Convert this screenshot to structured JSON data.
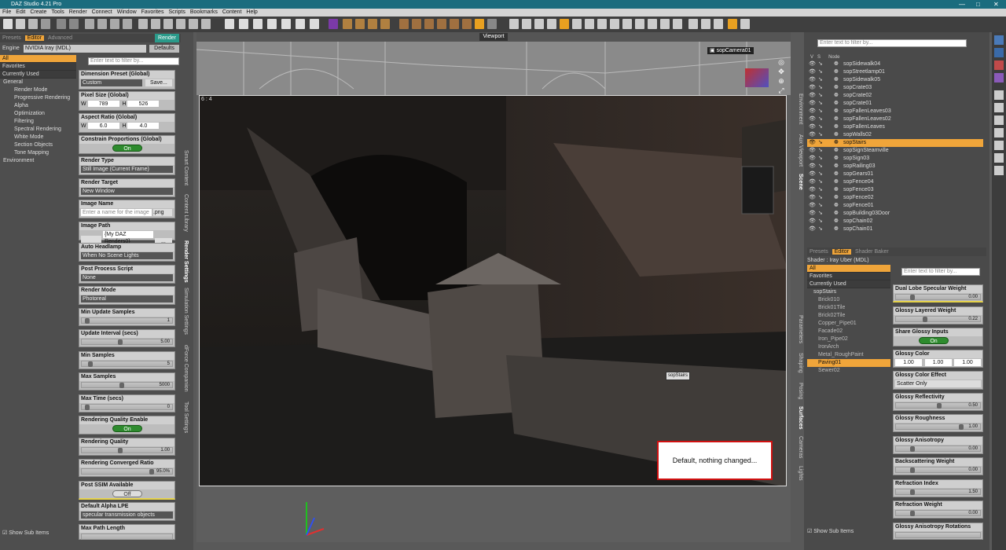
{
  "app": {
    "title": "DAZ Studio 4.21 Pro"
  },
  "window_controls": {
    "min": "—",
    "max": "□",
    "close": "✕"
  },
  "menu": [
    "File",
    "Edit",
    "Create",
    "Tools",
    "Render",
    "Connect",
    "Window",
    "Favorites",
    "Scripts",
    "Bookmarks",
    "Content",
    "Help"
  ],
  "left": {
    "tabs": [
      "Presets",
      "Editor",
      "Advanced"
    ],
    "render_btn": "Render",
    "engine_label": "Engine",
    "engine_value": "NVIDIA Iray (MDL)",
    "defaults_btn": "Defaults",
    "filter_placeholder": "Enter text to filter by...",
    "categories": [
      "All",
      "Favorites",
      "Currently Used"
    ],
    "tree": [
      "General",
      "Render Mode",
      "Progressive Rendering",
      "Alpha",
      "Optimization",
      "Filtering",
      "Spectral Rendering",
      "White Mode",
      "Section Objects",
      "Tone Mapping",
      "Environment"
    ],
    "show_sub": "Show Sub Items",
    "vtabs": [
      "Smart Content",
      "Content Library",
      "Render Settings",
      "Simulation Settings",
      "dForce Companion",
      "Tool Settings"
    ],
    "settings": {
      "dimension_title": "Dimension Preset (Global)",
      "dimension_value": "Custom",
      "save_btn": "Save...",
      "pixel_title": "Pixel Size (Global)",
      "w_label": "W",
      "h_label": "H",
      "pixel_w": "789",
      "pixel_h": "526",
      "aspect_title": "Aspect Ratio (Global)",
      "aspect_w": "6.0",
      "aspect_h": "4.0",
      "constrain_title": "Constrain Proportions (Global)",
      "on": "On",
      "off": "Off",
      "render_type_title": "Render Type",
      "render_type_value": "Still Image (Current Frame)",
      "render_target_title": "Render Target",
      "render_target_value": "New Window",
      "image_name_title": "Image Name",
      "image_name_placeholder": "Enter a name for the image",
      "image_name_ext": ".png",
      "image_path_title": "Image Path",
      "image_path_value": "{My DAZ Renders0}",
      "browse_btn": "...",
      "headlamp_title": "Auto Headlamp",
      "headlamp_value": "When No Scene Lights",
      "postproc_title": "Post Process Script",
      "postproc_value": "None",
      "render_mode_title": "Render Mode",
      "render_mode_value": "Photoreal",
      "min_update_title": "Min Update Samples",
      "min_update_value": "1",
      "update_interval_title": "Update Interval (secs)",
      "update_interval_value": "5.00",
      "min_samples_title": "Min Samples",
      "min_samples_value": "5",
      "max_samples_title": "Max Samples",
      "max_samples_value": "5000",
      "max_time_title": "Max Time (secs)",
      "max_time_value": "0",
      "rq_enable_title": "Rendering Quality Enable",
      "rq_title": "Rendering Quality",
      "rq_value": "1.00",
      "conv_title": "Rendering Converged Ratio",
      "conv_value": "95.0%",
      "ssim_title": "Post SSIM Available",
      "alpha_lpe_title": "Default Alpha LPE",
      "alpha_lpe_value": "specular transmission objects",
      "max_path_title": "Max Path Length"
    }
  },
  "viewport": {
    "title": "Viewport",
    "camera": "sopCamera01",
    "aspect_label": "6 : 4",
    "tooltip": "sopStairs",
    "notice": "Default, nothing changed..."
  },
  "scene": {
    "filter_placeholder": "Enter text to filter by...",
    "headers": [
      "V",
      "S",
      "Node"
    ],
    "nodes": [
      "sopSidewalk04",
      "sopStreetlamp01",
      "sopSidewalk05",
      "sopCrate03",
      "sopCrate02",
      "sopCrate01",
      "sopFallenLeaves03",
      "sopFallenLeaves02",
      "sopFallenLeaves",
      "sopWalls02",
      "sopStairs",
      "sopSignSteamville",
      "sopSign03",
      "sopRailing03",
      "sopGears01",
      "sopFence04",
      "sopFence03",
      "sopFence02",
      "sopFence01",
      "sopBuilding03Door",
      "sopChain02",
      "sopChain01"
    ],
    "selected": "sopStairs",
    "vtabs": [
      "Environment",
      "Aux Viewport",
      "Scene"
    ]
  },
  "surfaces": {
    "tabs": [
      "Presets",
      "Editor",
      "Shader Baker"
    ],
    "shader": "Shader : Iray Uber (MDL)",
    "filter_placeholder": "Enter text to filter by...",
    "categories": [
      "All",
      "Favorites",
      "Currently Used"
    ],
    "root": "sopStairs",
    "items": [
      "Brick010",
      "Brick01Tile",
      "Brick02Tile",
      "Copper_Pipe01",
      "Facade02",
      "Iron_Pipe02",
      "IronArch",
      "Metal_RoughPaint",
      "Paving01",
      "Sewer02"
    ],
    "selected": "Paving01",
    "show_sub": "Show Sub Items",
    "vtabs": [
      "Parameters",
      "Shaping",
      "Posing",
      "Surfaces",
      "Cameras",
      "Lights"
    ],
    "props": {
      "dual_lobe_title": "Dual Lobe Specular Weight",
      "dual_lobe_value": "0.00",
      "glossy_layered_title": "Glossy Layered Weight",
      "glossy_layered_value": "0.22",
      "share_glossy_title": "Share Glossy Inputs",
      "on": "On",
      "glossy_color_title": "Glossy Color",
      "glossy_color_r": "1.00",
      "glossy_color_g": "1.00",
      "glossy_color_b": "1.00",
      "glossy_effect_title": "Glossy Color Effect",
      "glossy_effect_value": "Scatter Only",
      "glossy_refl_title": "Glossy Reflectivity",
      "glossy_refl_value": "0.50",
      "glossy_rough_title": "Glossy Roughness",
      "glossy_rough_value": "1.00",
      "glossy_aniso_title": "Glossy Anisotropy",
      "glossy_aniso_value": "0.00",
      "backscatter_title": "Backscattering Weight",
      "backscatter_value": "0.00",
      "refr_index_title": "Refraction Index",
      "refr_index_value": "1.50",
      "refr_weight_title": "Refraction Weight",
      "refr_weight_value": "0.00",
      "aniso_rot_title": "Glossy Anisotropy Rotations"
    }
  },
  "colors": {
    "accent": "#f0a53a",
    "titlebar": "#1b6c7e",
    "toggle_on": "#2e8b2e",
    "notice_border": "#d01010"
  }
}
